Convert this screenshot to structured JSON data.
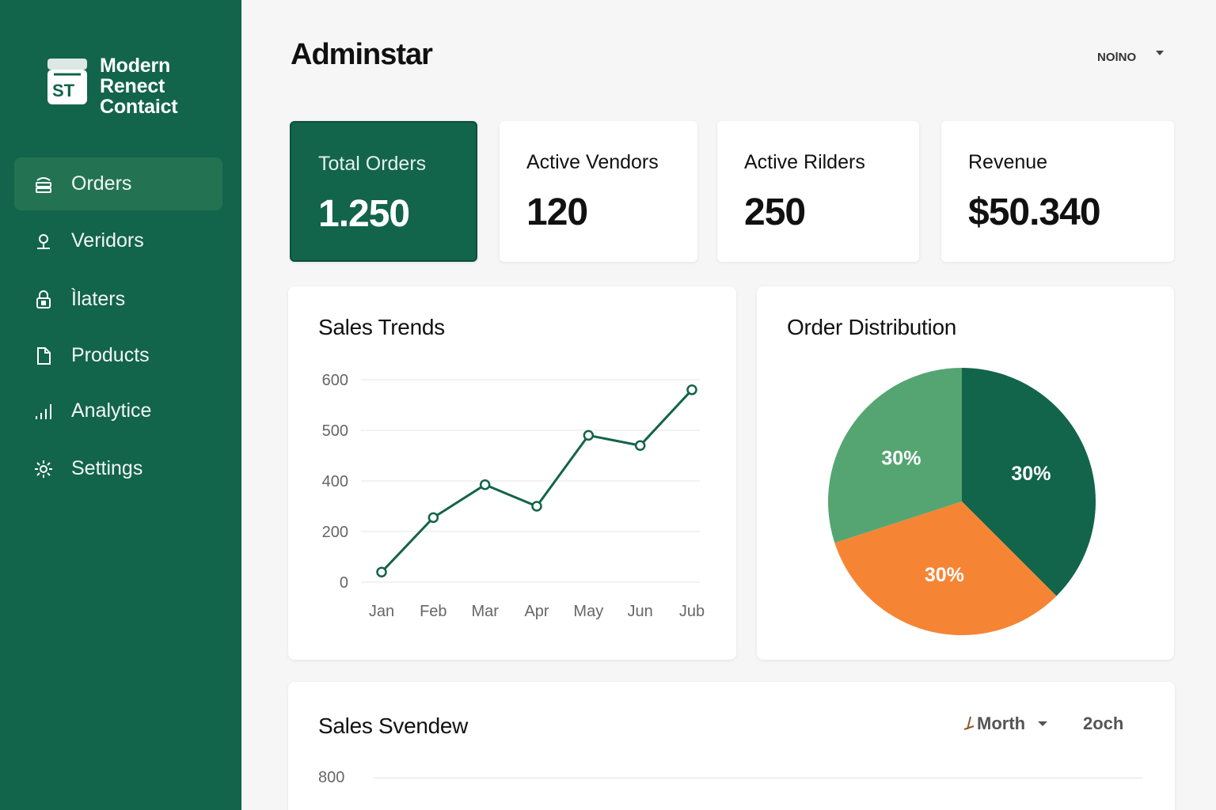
{
  "colors": {
    "sidebar": "#12644a",
    "active_item": "#237353",
    "line": "#12644a",
    "pie_dark": "#12644a",
    "pie_light": "#55a572",
    "pie_orange": "#f58535"
  },
  "sidebar": {
    "brand": {
      "logo_icon": "store-bag-icon",
      "name_lines": [
        "Modern",
        "Renect",
        "Contaict"
      ]
    },
    "items": [
      {
        "label": "Orders",
        "icon": "inbox-stack-icon",
        "active": true
      },
      {
        "label": "Veridors",
        "icon": "person-icon",
        "active": false
      },
      {
        "label": "Ìlaters",
        "icon": "lock-icon",
        "active": false
      },
      {
        "label": "Products",
        "icon": "document-icon",
        "active": false
      },
      {
        "label": "Analytice",
        "icon": "bar-chart-icon",
        "active": false
      },
      {
        "label": "Settings",
        "icon": "gear-icon",
        "active": false
      }
    ]
  },
  "header": {
    "title": "Adminstar",
    "user": {
      "name": "NOlNO",
      "icon": "chevron-down-icon"
    }
  },
  "stats": [
    {
      "label": "Total Orders",
      "value": "1.250"
    },
    {
      "label": "Active Vendors",
      "value": "120"
    },
    {
      "label": "Active Rilders",
      "value": "250"
    },
    {
      "label": "Revenue",
      "value": "$50.340"
    }
  ],
  "sales_trends": {
    "title": "Sales Trends"
  },
  "order_distribution": {
    "title": "Order Distribution"
  },
  "sales_overview": {
    "title": "Sales Svendew",
    "period_select": "Morth",
    "period_icon": "pin-icon",
    "second_select": "2och",
    "tick_label": "800"
  },
  "chart_data": [
    {
      "type": "line",
      "title": "Sales Trends",
      "x": [
        "Jan",
        "Feb",
        "Mar",
        "Apr",
        "May",
        "Jun",
        "Jub"
      ],
      "y_ticks": [
        "0",
        "200",
        "400",
        "500",
        "600"
      ],
      "ylim": [
        0,
        600
      ],
      "values": [
        40,
        255,
        385,
        300,
        490,
        470,
        580
      ],
      "grid": true
    },
    {
      "type": "pie",
      "title": "Order Distribution",
      "slices": [
        {
          "label": "30%",
          "value": 37.5,
          "color": "#12644a"
        },
        {
          "label": "30%",
          "value": 32.5,
          "color": "#f58535"
        },
        {
          "label": "30%",
          "value": 30,
          "color": "#55a572"
        }
      ]
    }
  ]
}
